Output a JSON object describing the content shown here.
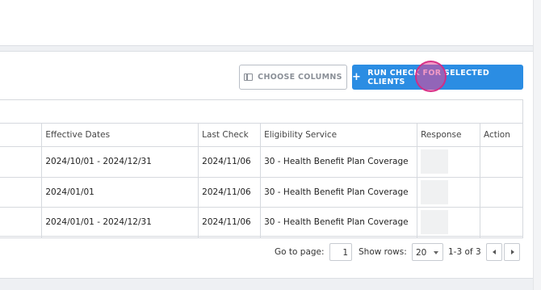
{
  "toolbar": {
    "choose_columns_label": "CHOOSE COLUMNS",
    "run_check_label": "RUN CHECK FOR SELECTED CLIENTS",
    "run_check_icon": "+"
  },
  "table": {
    "headers": [
      "",
      "Effective Dates",
      "Last Check",
      "Eligibility Service",
      "Response",
      "Action"
    ],
    "rows": [
      {
        "effective_dates": "2024/10/01 - 2024/12/31",
        "last_check": "2024/11/06",
        "service": "30 - Health Benefit Plan Coverage"
      },
      {
        "effective_dates": "2024/01/01",
        "last_check": "2024/11/06",
        "service": "30 - Health Benefit Plan Coverage"
      },
      {
        "effective_dates": "2024/01/01 - 2024/12/31",
        "last_check": "2024/11/06",
        "service": "30 - Health Benefit Plan Coverage"
      }
    ]
  },
  "pager": {
    "go_to_page_label": "Go to page:",
    "page_value": "1",
    "show_rows_label": "Show rows:",
    "rows_value": "20",
    "range_text": "1-3 of 3"
  },
  "colors": {
    "primary": "#2b8de3",
    "click_highlight": "#e84696"
  }
}
